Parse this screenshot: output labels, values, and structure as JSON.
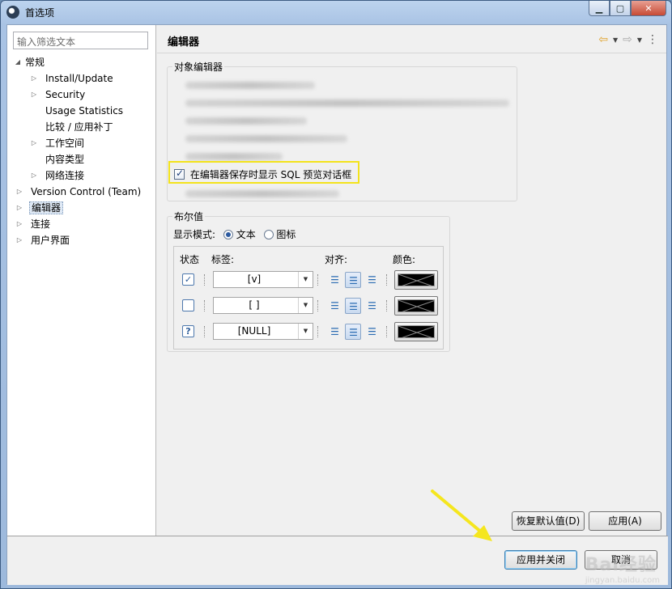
{
  "window": {
    "title": "首选项"
  },
  "filter": {
    "placeholder": "输入筛选文本"
  },
  "tree": [
    {
      "label": "常规",
      "expanded": true
    },
    {
      "label": "Install/Update"
    },
    {
      "label": "Security"
    },
    {
      "label": "Usage Statistics"
    },
    {
      "label": "比较 / 应用补丁"
    },
    {
      "label": "工作空间"
    },
    {
      "label": "内容类型"
    },
    {
      "label": "网络连接"
    },
    {
      "label": "Version Control (Team)"
    },
    {
      "label": "编辑器",
      "selected": true
    },
    {
      "label": "连接"
    },
    {
      "label": "用户界面"
    }
  ],
  "page": {
    "title": "编辑器"
  },
  "object_editor": {
    "group_title": "对象编辑器",
    "highlight_option": {
      "label": "在编辑器保存时显示 SQL 预览对话框",
      "checked": true
    }
  },
  "boolean": {
    "group_title": "布尔值",
    "display_mode_label": "显示模式:",
    "mode_text": "文本",
    "mode_icon": "图标",
    "selected_mode": "文本",
    "headers": {
      "state": "状态",
      "label": "标签:",
      "align": "对齐:",
      "color": "颜色:"
    },
    "rows": [
      {
        "state_icon": "checked-icon",
        "label": "[v]",
        "align": "center"
      },
      {
        "state_icon": "unchecked-icon",
        "label": "[ ]",
        "align": "center"
      },
      {
        "state_icon": "unknown-icon",
        "label": "[NULL]",
        "align": "center"
      }
    ]
  },
  "buttons": {
    "restore_defaults": "恢复默认值(D)",
    "apply": "应用(A)",
    "apply_close": "应用并关闭",
    "cancel": "取消"
  },
  "watermark": {
    "brand": "Bai经验",
    "url": "jingyan.baidu.com"
  },
  "colors": {
    "highlight": "#f3e31c",
    "arrow": "#f5e61e",
    "selection": "#dfe9f5"
  }
}
